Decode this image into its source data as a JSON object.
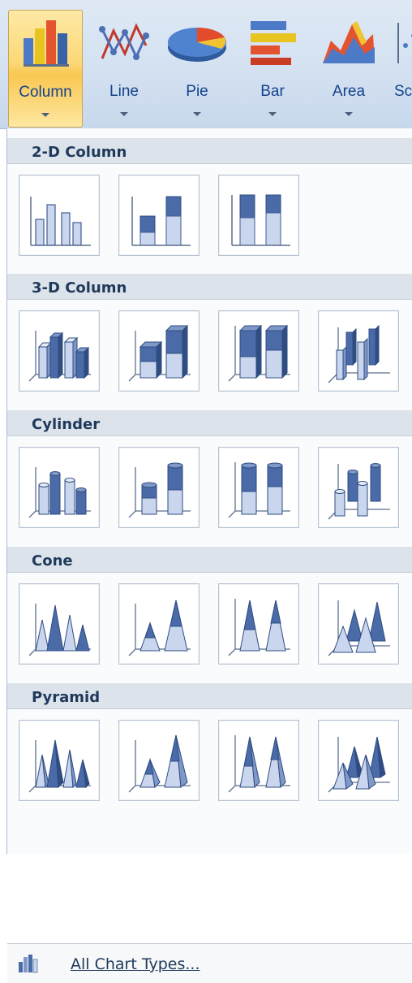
{
  "ribbon": {
    "buttons": [
      {
        "label": "Column",
        "icon": "column-chart-icon",
        "active": true
      },
      {
        "label": "Line",
        "icon": "line-chart-icon",
        "active": false
      },
      {
        "label": "Pie",
        "icon": "pie-chart-icon",
        "active": false
      },
      {
        "label": "Bar",
        "icon": "bar-chart-icon",
        "active": false
      },
      {
        "label": "Area",
        "icon": "area-chart-icon",
        "active": false
      },
      {
        "label": "Sc",
        "icon": "scatter-chart-icon",
        "active": false
      }
    ],
    "colors": {
      "accent_hover": "#fcd877",
      "label": "#15428b"
    }
  },
  "gallery": {
    "categories": [
      {
        "title": "2-D Column",
        "tiles": [
          "clustered-column-icon",
          "stacked-column-icon",
          "100-stacked-column-icon"
        ]
      },
      {
        "title": "3-D Column",
        "tiles": [
          "3d-clustered-column-icon",
          "3d-stacked-column-icon",
          "3d-100-stacked-column-icon",
          "3d-column-icon"
        ]
      },
      {
        "title": "Cylinder",
        "tiles": [
          "clustered-cylinder-icon",
          "stacked-cylinder-icon",
          "100-stacked-cylinder-icon",
          "3d-cylinder-icon"
        ]
      },
      {
        "title": "Cone",
        "tiles": [
          "clustered-cone-icon",
          "stacked-cone-icon",
          "100-stacked-cone-icon",
          "3d-cone-icon"
        ]
      },
      {
        "title": "Pyramid",
        "tiles": [
          "clustered-pyramid-icon",
          "stacked-pyramid-icon",
          "100-stacked-pyramid-icon",
          "3d-pyramid-icon"
        ]
      }
    ],
    "footer": {
      "label": "All Chart Types...",
      "icon": "chart-types-icon"
    },
    "colors": {
      "header_bg": "#dde3ea",
      "header_text": "#1e395b",
      "fill_dark": "#4a6aa8",
      "fill_light": "#c9d6ee"
    }
  }
}
